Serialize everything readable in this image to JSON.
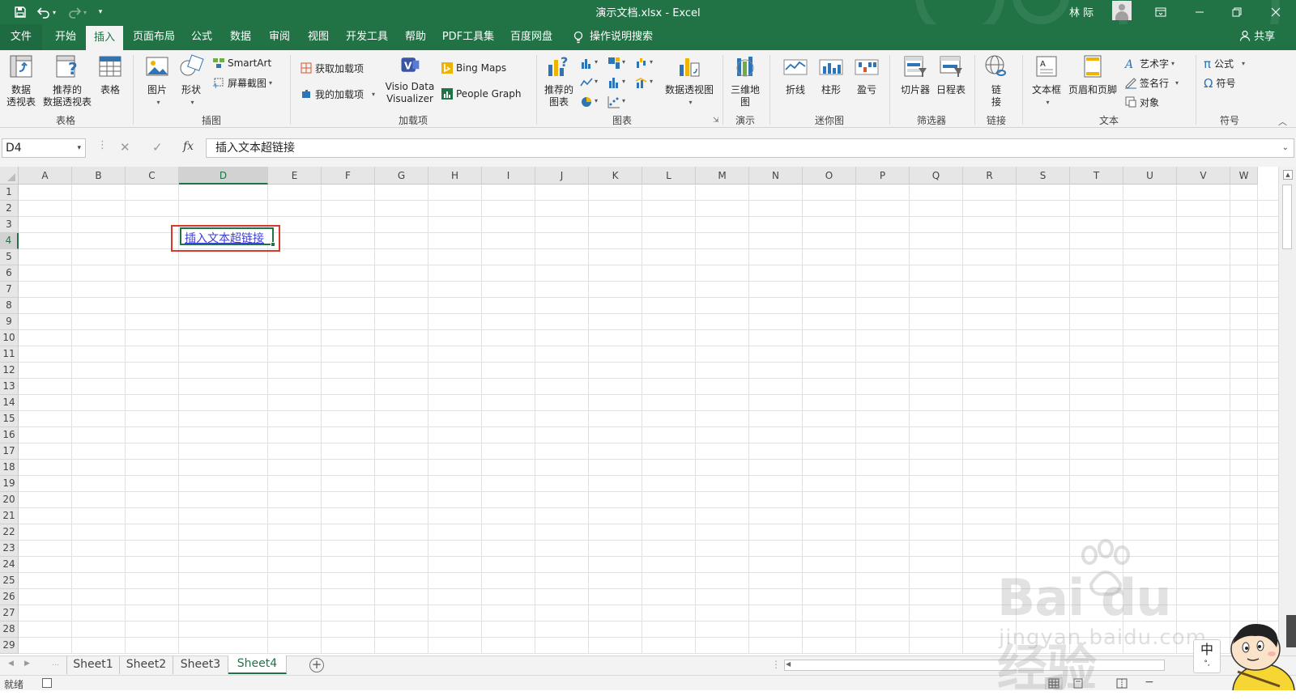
{
  "window": {
    "title": "演示文档.xlsx  -  Excel",
    "user": "林 际",
    "tabs": [
      {
        "label": "文件"
      },
      {
        "label": "开始"
      },
      {
        "label": "插入"
      },
      {
        "label": "页面布局"
      },
      {
        "label": "公式"
      },
      {
        "label": "数据"
      },
      {
        "label": "审阅"
      },
      {
        "label": "视图"
      },
      {
        "label": "开发工具"
      },
      {
        "label": "帮助"
      },
      {
        "label": "PDF工具集"
      },
      {
        "label": "百度网盘"
      }
    ],
    "active_tab": "插入",
    "tell_me": "操作说明搜索",
    "share": "共享"
  },
  "ribbon": {
    "groups": {
      "tables": "表格",
      "illustrations": "插图",
      "addins": "加载项",
      "charts": "图表",
      "tours": "演示",
      "sparklines": "迷你图",
      "filters": "筛选器",
      "links": "链接",
      "text": "文本",
      "symbols": "符号"
    },
    "buttons": {
      "pivot_table_1": "数据",
      "pivot_table_2": "透视表",
      "rec_pivot_1": "推荐的",
      "rec_pivot_2": "数据透视表",
      "table": "表格",
      "pictures": "图片",
      "shapes": "形状",
      "smartart": "SmartArt",
      "screenshot": "屏幕截图",
      "get_addins": "获取加载项",
      "my_addins": "我的加载项",
      "visio_1": "Visio Data",
      "visio_2": "Visualizer",
      "bing_maps": "Bing Maps",
      "people_graph": "People Graph",
      "rec_charts_1": "推荐的",
      "rec_charts_2": "图表",
      "pivot_chart": "数据透视图",
      "map3d_1": "三维地",
      "map3d_2": "图",
      "line": "折线",
      "column": "柱形",
      "win_loss": "盈亏",
      "slicer": "切片器",
      "timeline": "日程表",
      "link_1": "链",
      "link_2": "接",
      "textbox": "文本框",
      "header_footer": "页眉和页脚",
      "wordart": "艺术字",
      "signature": "签名行",
      "object": "对象",
      "equation": "公式",
      "symbol": "符号"
    }
  },
  "formula_bar": {
    "name_box": "D4",
    "fx": "fx",
    "content": "插入文本超链接"
  },
  "sheet": {
    "columns": [
      "A",
      "B",
      "C",
      "D",
      "E",
      "F",
      "G",
      "H",
      "I",
      "J",
      "K",
      "L",
      "M",
      "N",
      "O",
      "P",
      "Q",
      "R",
      "S",
      "T",
      "U",
      "V",
      "W"
    ],
    "rows": [
      "1",
      "2",
      "3",
      "4",
      "5",
      "6",
      "7",
      "8",
      "9",
      "10",
      "11",
      "12",
      "13",
      "14",
      "15",
      "16",
      "17",
      "18",
      "19",
      "20",
      "21",
      "22",
      "23",
      "24",
      "25",
      "26",
      "27",
      "28",
      "29"
    ],
    "selected_cell": "D4",
    "cell_d4_text": "插入文本超链接",
    "hyperlink_color": "#3f3fd4",
    "highlight_color": "#d9392c"
  },
  "sheet_tabs": [
    {
      "label": "Sheet1"
    },
    {
      "label": "Sheet2"
    },
    {
      "label": "Sheet3"
    },
    {
      "label": "Sheet4"
    }
  ],
  "active_sheet": "Sheet4",
  "status": {
    "ready": "就绪"
  },
  "watermark": {
    "brand": "Bai  du 经验",
    "url": "jingyan.baidu.com"
  },
  "ime": {
    "label": "中"
  },
  "colors": {
    "excel_green": "#217346",
    "ribbon_bg": "#f3f3f3"
  }
}
